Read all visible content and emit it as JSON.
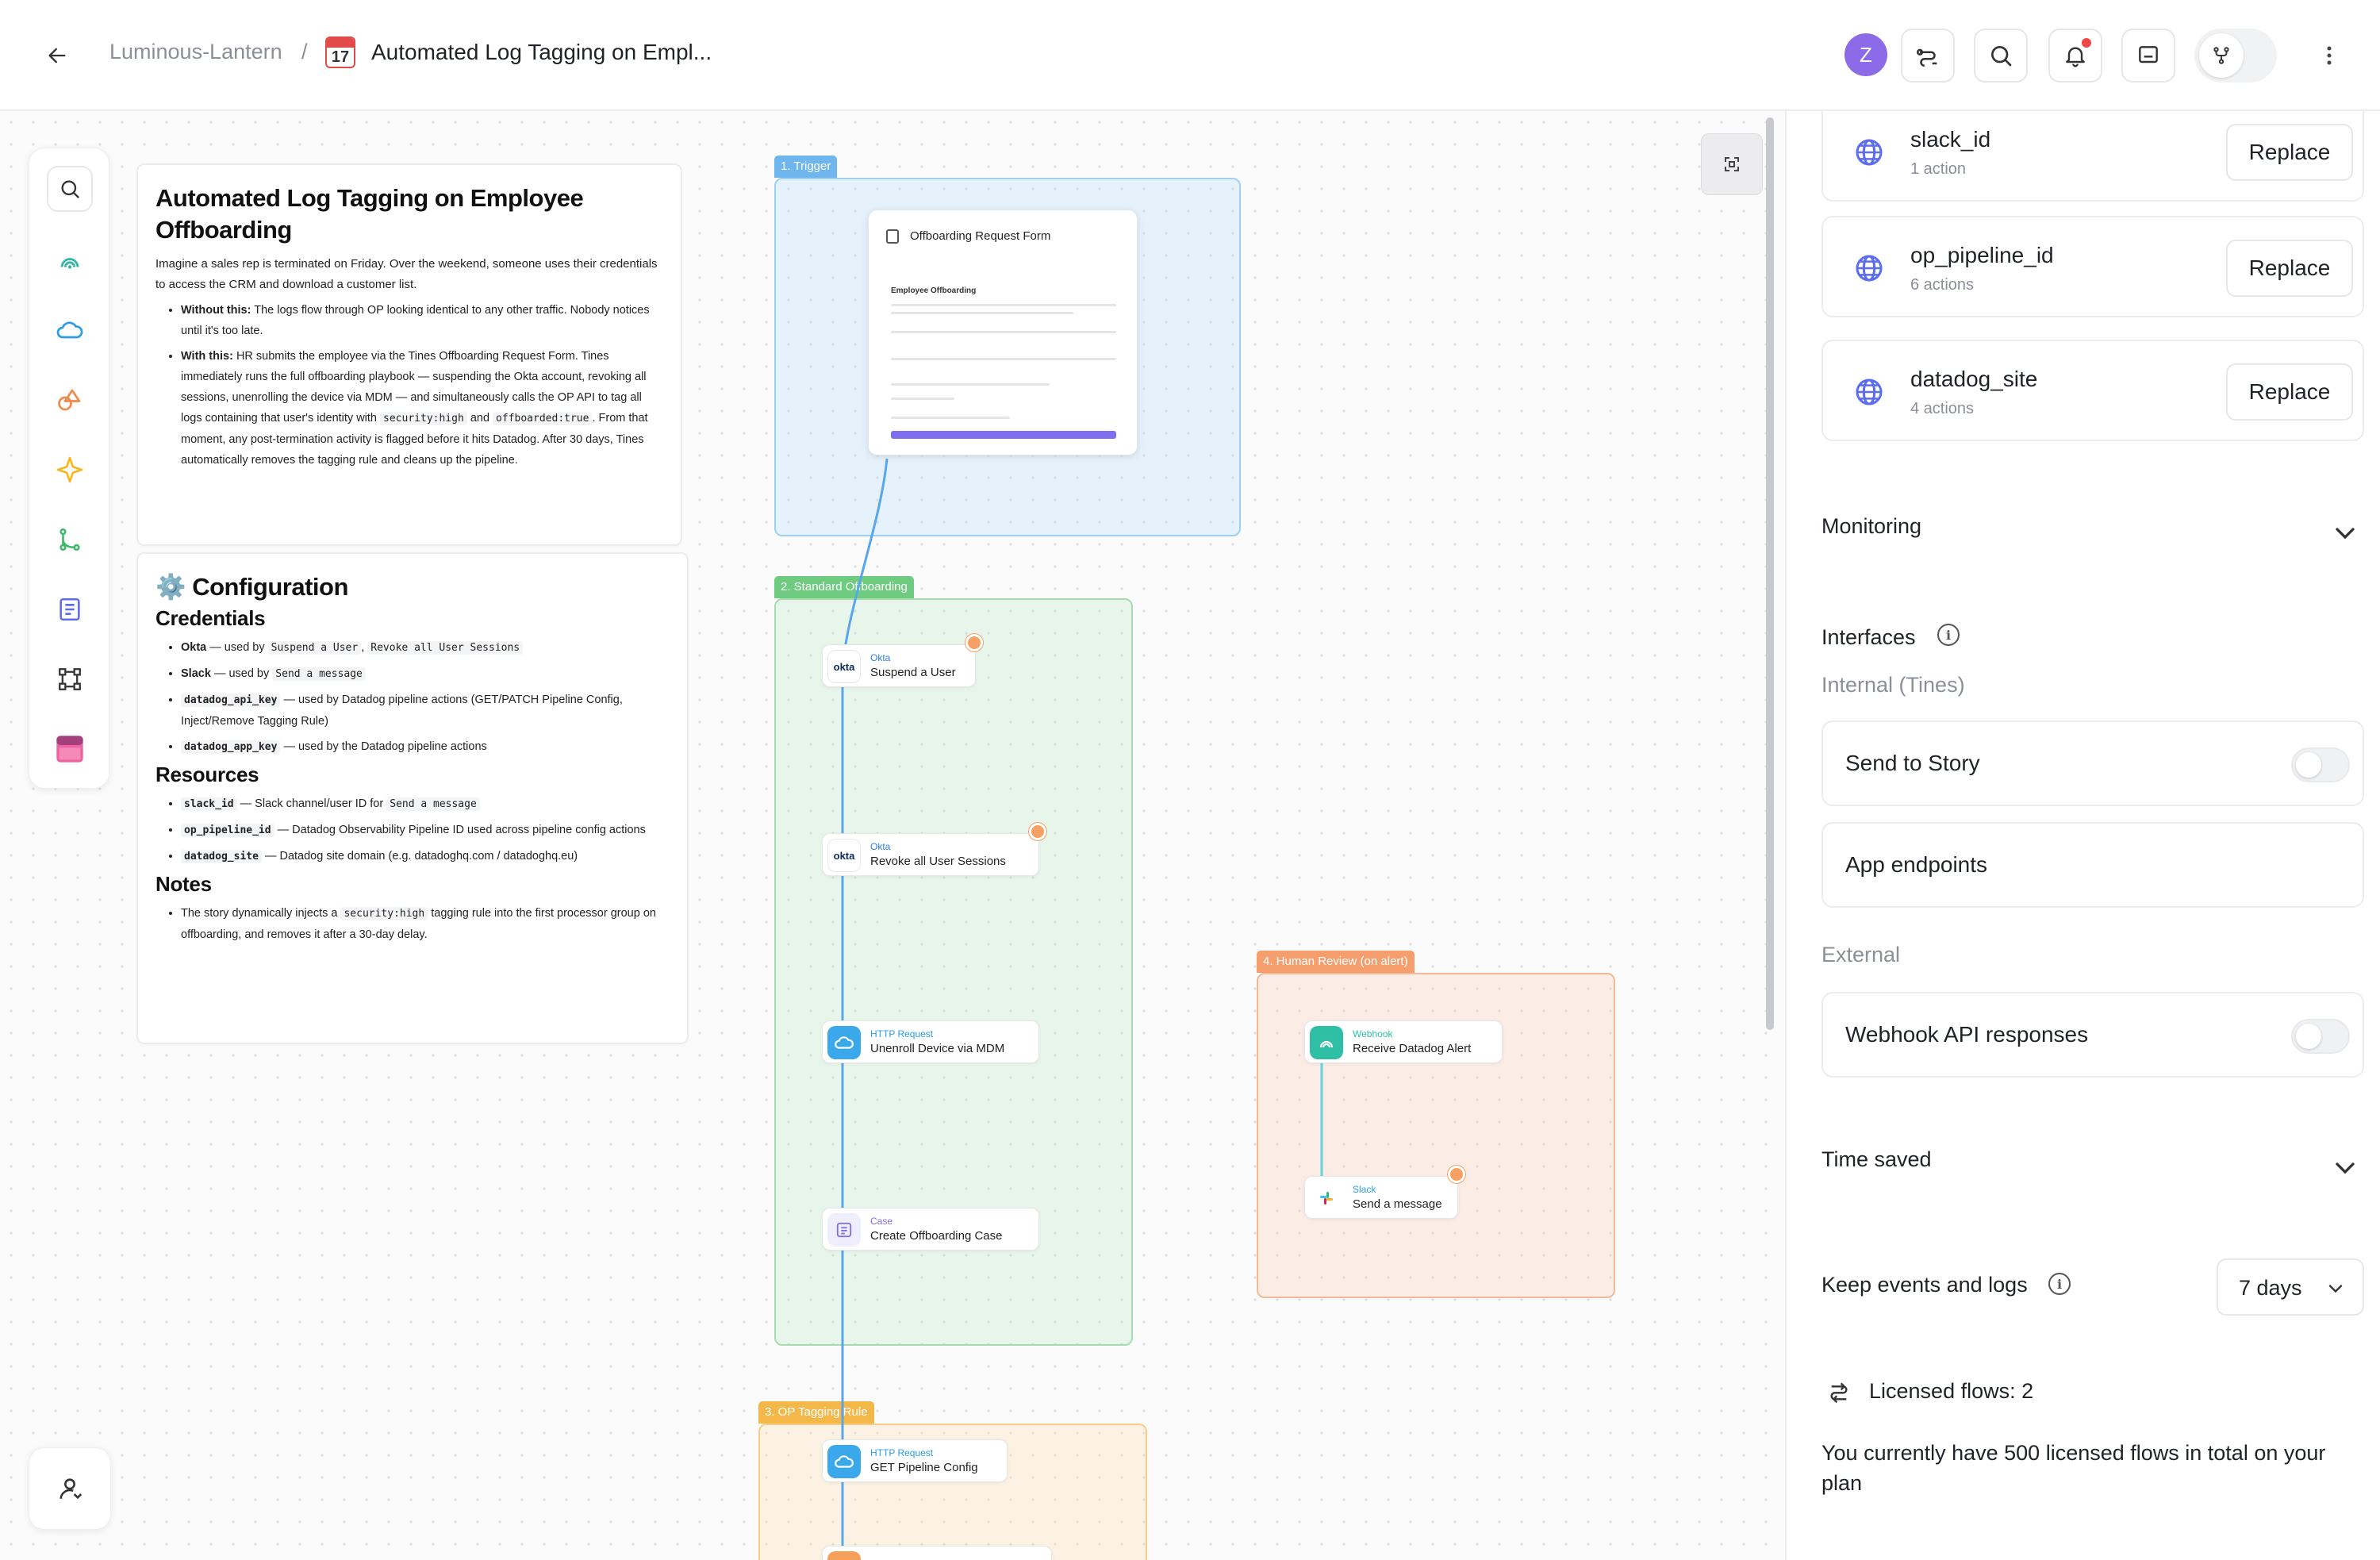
{
  "header": {
    "workspace": "Luminous-Lantern",
    "separator": "/",
    "story_emoji_day": "17",
    "story_title": "Automated Log Tagging on Empl...",
    "avatar_initial": "Z"
  },
  "colors": {
    "accent": "#8c6be8",
    "trigger": "#6fb5ee",
    "standard": "#6ecb80",
    "human": "#f59e6e",
    "op": "#f3b74a",
    "notification": "#f04646"
  },
  "canvas": {
    "intro": {
      "title": "Automated Log Tagging on Employee Offboarding",
      "lead": "Imagine a sales rep is terminated on Friday. Over the weekend, someone uses their credentials to access the CRM and download a customer list.",
      "without_label": "Without this:",
      "without_text": "The logs flow through OP looking identical to any other traffic. Nobody notices until it's too late.",
      "with_label": "With this:",
      "with_text_1": "HR submits the employee via the Tines Offboarding Request Form. Tines immediately runs the full offboarding playbook — suspending the Okta account, revoking all sessions, unenrolling the device via MDM — and simultaneously calls the OP API to tag all logs containing that user's identity with",
      "with_code_1": "security:high",
      "with_and": "and",
      "with_code_2": "offboarded:true",
      "with_text_2": ". From that moment, any post-termination activity is flagged before it hits Datadog. After 30 days, Tines automatically removes the tagging rule and cleans up the pipeline."
    },
    "config": {
      "title": "Configuration",
      "gear": "⚙️",
      "credentials_heading": "Credentials",
      "cred_okta_name": "Okta",
      "cred_okta_text": "— used by",
      "cred_okta_code1": "Suspend a User",
      "cred_okta_comma": ",",
      "cred_okta_code2": "Revoke all User Sessions",
      "cred_slack_name": "Slack",
      "cred_slack_text": "— used by",
      "cred_slack_code": "Send a message",
      "cred_api_key": "datadog_api_key",
      "cred_api_text": "— used by Datadog pipeline actions (GET/PATCH Pipeline Config, Inject/Remove Tagging Rule)",
      "cred_app_key": "datadog_app_key",
      "cred_app_text": "— used by the Datadog pipeline actions",
      "resources_heading": "Resources",
      "res_slack": "slack_id",
      "res_slack_text": "— Slack channel/user ID for",
      "res_slack_code": "Send a message",
      "res_pipeline": "op_pipeline_id",
      "res_pipeline_text": "— Datadog Observability Pipeline ID used across pipeline config actions",
      "res_site": "datadog_site",
      "res_site_text": "— Datadog site domain (e.g. datadoghq.com / datadoghq.eu)",
      "notes_heading": "Notes",
      "note_text_1": "The story dynamically injects a",
      "note_code": "security:high",
      "note_text_2": "tagging rule into the first processor group on offboarding, and removes it after a 30-day delay."
    },
    "groups": {
      "trigger": "1. Trigger",
      "standard": "2. Standard Offboarding",
      "op": "3. OP Tagging Rule",
      "human": "4. Human Review (on alert)"
    },
    "form": {
      "title": "Offboarding Request Form",
      "heading": "Employee Offboarding"
    },
    "actions": [
      {
        "type": "Okta",
        "name": "Suspend a User",
        "icon": "okta"
      },
      {
        "type": "Okta",
        "name": "Revoke all User Sessions",
        "icon": "okta"
      },
      {
        "type": "HTTP Request",
        "name": "Unenroll Device via MDM",
        "icon": "http"
      },
      {
        "type": "Case",
        "name": "Create Offboarding Case",
        "icon": "case"
      },
      {
        "type": "Webhook",
        "name": "Receive Datadog Alert",
        "icon": "webhook"
      },
      {
        "type": "Slack",
        "name": "Send a message",
        "icon": "slack"
      },
      {
        "type": "HTTP Request",
        "name": "GET Pipeline Config",
        "icon": "http"
      }
    ],
    "okta_logo_text": "okta"
  },
  "panel": {
    "resources": [
      {
        "name": "slack_id",
        "count": "1 action",
        "button": "Replace"
      },
      {
        "name": "op_pipeline_id",
        "count": "6 actions",
        "button": "Replace"
      },
      {
        "name": "datadog_site",
        "count": "4 actions",
        "button": "Replace"
      }
    ],
    "monitoring": "Monitoring",
    "interfaces": "Interfaces",
    "internal_label": "Internal (Tines)",
    "send_to_story": "Send to Story",
    "app_endpoints": "App endpoints",
    "external_label": "External",
    "webhook_responses": "Webhook API responses",
    "time_saved": "Time saved",
    "keep_events": "Keep events and logs",
    "retention_value": "7 days",
    "licensed_flows": "Licensed flows: 2",
    "licensed_desc": "You currently have 500 licensed flows in total on your plan"
  }
}
